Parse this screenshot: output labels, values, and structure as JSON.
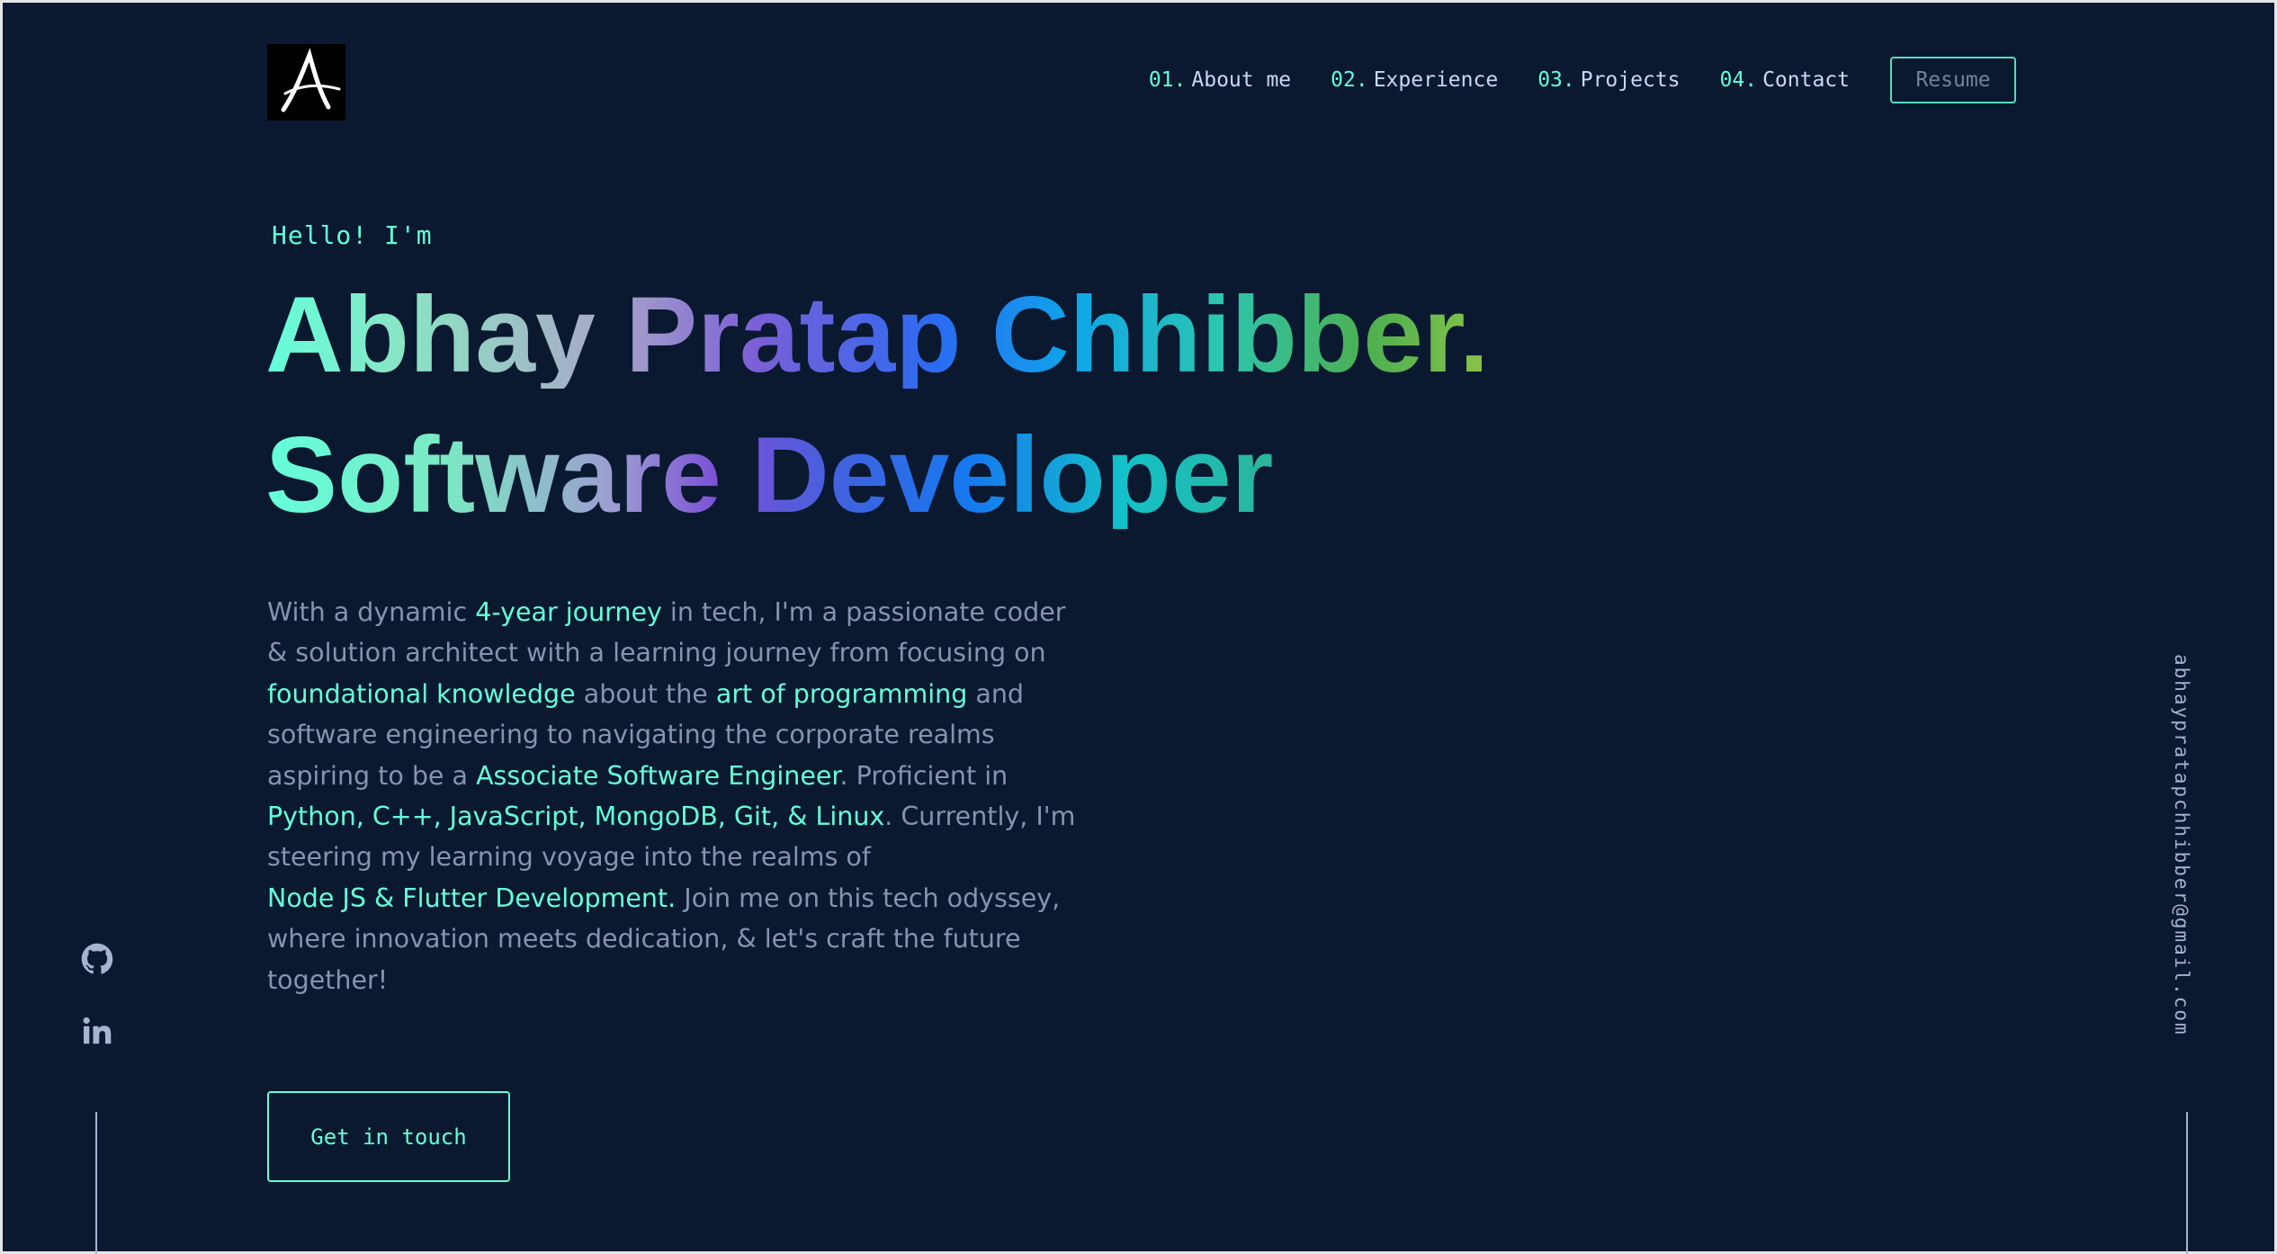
{
  "header": {
    "logo_letter": "A",
    "nav": [
      {
        "num": "01.",
        "label": "About me"
      },
      {
        "num": "02.",
        "label": "Experience"
      },
      {
        "num": "03.",
        "label": "Projects"
      },
      {
        "num": "04.",
        "label": "Contact"
      }
    ],
    "resume_label": "Resume"
  },
  "hero": {
    "greeting": "Hello! I'm",
    "name": "Abhay Pratap Chhibber.",
    "role": "Software Developer",
    "bio": [
      {
        "text": "With a dynamic ",
        "highlight": false
      },
      {
        "text": "4-year journey",
        "highlight": true
      },
      {
        "text": " in tech, I'm a passionate coder & solution architect with a learning journey from focusing on ",
        "highlight": false
      },
      {
        "text": "foundational knowledge",
        "highlight": true
      },
      {
        "text": " about the ",
        "highlight": false
      },
      {
        "text": "art of programming",
        "highlight": true
      },
      {
        "text": " and software engineering to navigating the corporate realms aspiring to be a ",
        "highlight": false
      },
      {
        "text": "Associate Software Engineer",
        "highlight": true
      },
      {
        "text": ". Proficient in ",
        "highlight": false
      },
      {
        "text": "Python, C++, JavaScript, MongoDB, Git, & Linux",
        "highlight": true
      },
      {
        "text": ". Currently, I'm steering my learning voyage into the realms of ",
        "highlight": false
      },
      {
        "text": "Node JS & Flutter Development.",
        "highlight": true
      },
      {
        "text": " Join me on this tech odyssey, where innovation meets dedication, & let's craft the future together!",
        "highlight": false
      }
    ],
    "cta_label": "Get in touch"
  },
  "sidebar": {
    "socials": [
      {
        "name": "github",
        "icon": "github-icon"
      },
      {
        "name": "linkedin",
        "icon": "linkedin-icon"
      }
    ],
    "email": "abhaypratapchhibber@gmail.com"
  },
  "colors": {
    "background": "#0a192f",
    "accent": "#64ffda",
    "text": "#8892b0",
    "heading": "#ccd6f6"
  }
}
